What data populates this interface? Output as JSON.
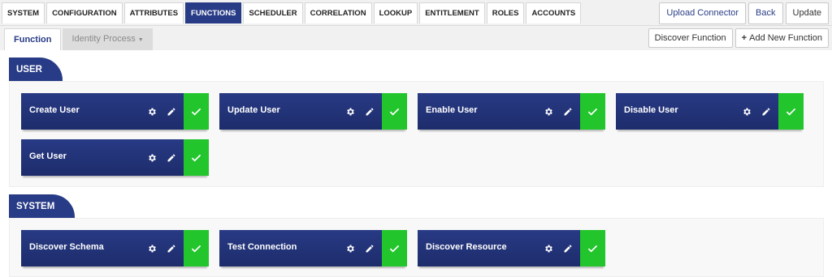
{
  "nav": {
    "tabs": [
      {
        "label": "SYSTEM"
      },
      {
        "label": "CONFIGURATION"
      },
      {
        "label": "ATTRIBUTES"
      },
      {
        "label": "FUNCTIONS",
        "active": true
      },
      {
        "label": "SCHEDULER"
      },
      {
        "label": "CORRELATION"
      },
      {
        "label": "LOOKUP"
      },
      {
        "label": "ENTITLEMENT"
      },
      {
        "label": "ROLES"
      },
      {
        "label": "ACCOUNTS"
      }
    ],
    "actions": {
      "upload": "Upload Connector",
      "back": "Back",
      "update": "Update"
    }
  },
  "subnav": {
    "tabs": [
      {
        "label": "Function",
        "active": true
      },
      {
        "label": "Identity Process",
        "active": false
      }
    ],
    "discover_label": "Discover Function",
    "add_label": "Add New Function"
  },
  "sections": [
    {
      "title": "USER",
      "functions": [
        "Create User",
        "Update User",
        "Enable User",
        "Disable User",
        "Get User"
      ]
    },
    {
      "title": "SYSTEM",
      "functions": [
        "Discover Schema",
        "Test Connection",
        "Discover Resource"
      ]
    }
  ],
  "colors": {
    "primary": "#283b86",
    "success": "#22c52c"
  },
  "icons": {
    "settings": "gear-icon",
    "edit": "pencil-icon",
    "status": "check-icon",
    "add": "plus-icon",
    "dropdown": "caret-down-icon"
  }
}
